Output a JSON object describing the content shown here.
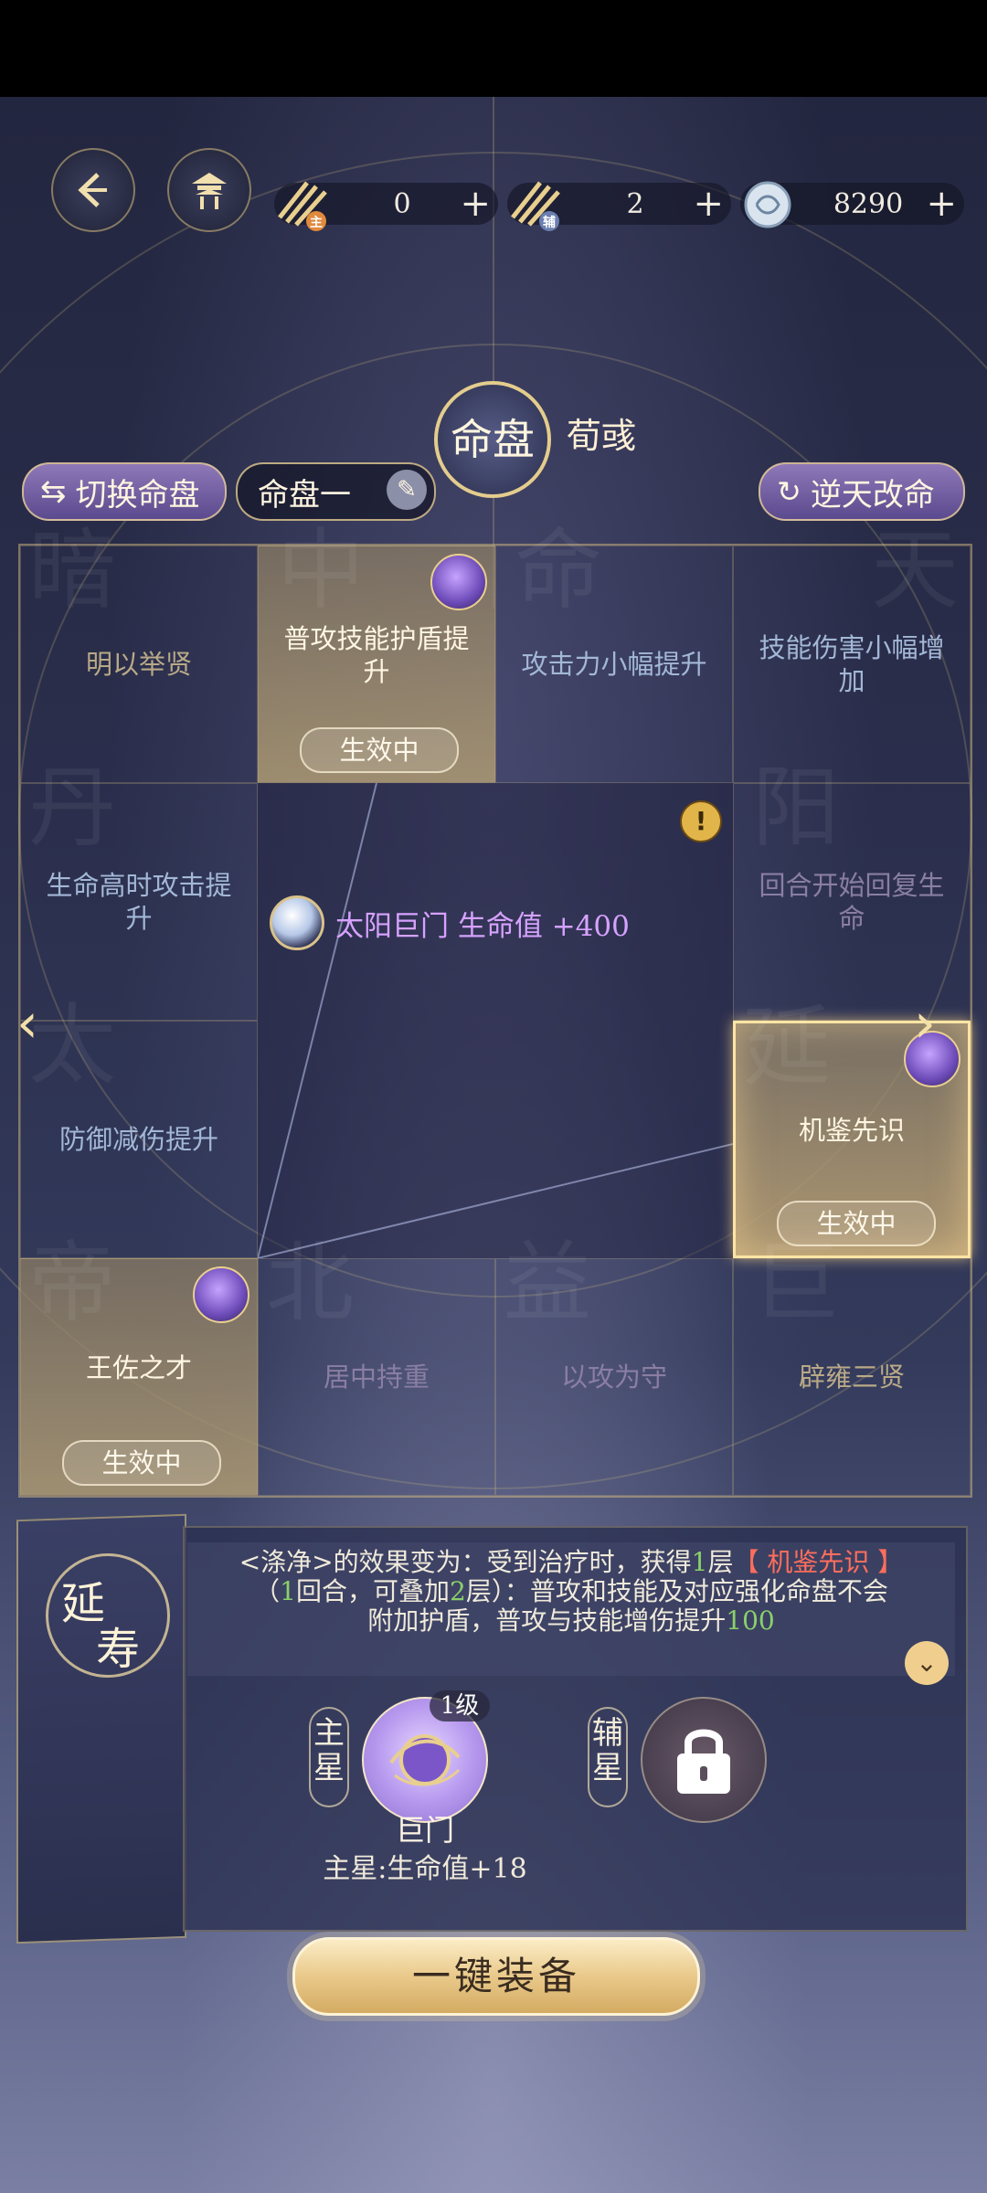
{
  "topbar": {
    "back_icon": "back-arrow-icon",
    "pavilion_icon": "pavilion-icon",
    "currencies": [
      {
        "icon": "main-star-token-icon",
        "badge": "主",
        "value": "0",
        "plus": "+"
      },
      {
        "icon": "aux-star-token-icon",
        "badge": "辅",
        "value": "2",
        "plus": "+"
      },
      {
        "icon": "silver-coin-icon",
        "badge": "",
        "value": "8290",
        "plus": "+"
      }
    ]
  },
  "header": {
    "emblem": "命盘",
    "name": "荀彧"
  },
  "controls": {
    "switch_label": "切换命盘",
    "current_plate": "命盘一",
    "defy_label": "逆天改命"
  },
  "grid": {
    "cells": [
      {
        "label": "明以举贤",
        "status": "",
        "watermark": "暗"
      },
      {
        "label": "普攻技能护盾提升",
        "status": "生效中",
        "watermark": "中"
      },
      {
        "label": "攻击力小幅提升",
        "status": "",
        "watermark": "命"
      },
      {
        "label": "技能伤害小幅增加",
        "status": "",
        "watermark": "天"
      },
      {
        "label": "生命高时攻击提升",
        "status": "",
        "watermark": "丹"
      },
      {
        "label": "回合开始回复生命",
        "status": "",
        "watermark": "阳"
      },
      {
        "label": "防御减伤提升",
        "status": "",
        "watermark": "太"
      },
      {
        "label": "机鉴先识",
        "status": "生效中",
        "watermark": "延"
      },
      {
        "label": "王佐之才",
        "status": "生效中",
        "watermark": "帝"
      },
      {
        "label": "居中持重",
        "status": "",
        "watermark": "北"
      },
      {
        "label": "以攻为守",
        "status": "",
        "watermark": "益"
      },
      {
        "label": "辟雍三贤",
        "status": "",
        "watermark": "巨"
      }
    ],
    "center_info": "太阳巨门 生命值 +400",
    "alert": "!"
  },
  "detail": {
    "title_top": "延",
    "title_bottom": "寿",
    "desc_line1_a": "<涤净>的效果变为：受到治疗时，获得",
    "desc_line1_num": "1",
    "desc_line1_b": "层",
    "desc_line1_tag": "【 机鉴先识 】",
    "desc_line2_a": "（",
    "desc_line2_num1": "1",
    "desc_line2_b": "回合，可叠加",
    "desc_line2_num2": "2",
    "desc_line2_c": "层）：普攻和技能及对应强化命盘不会",
    "desc_line3_a": "附加护盾，普攻与技能增伤提升",
    "desc_line3_num": "100",
    "main_star_tag": "主星",
    "aux_star_tag": "辅星",
    "star_level": "1级",
    "star_name": "巨门",
    "star_bonus": "主星:生命值+18"
  },
  "equip_button": "一键装备",
  "colors": {
    "gold": "#e9cf8e",
    "green": "#8ad06a",
    "red": "#ff6e5c",
    "purple_text": "#d6a2ff"
  }
}
